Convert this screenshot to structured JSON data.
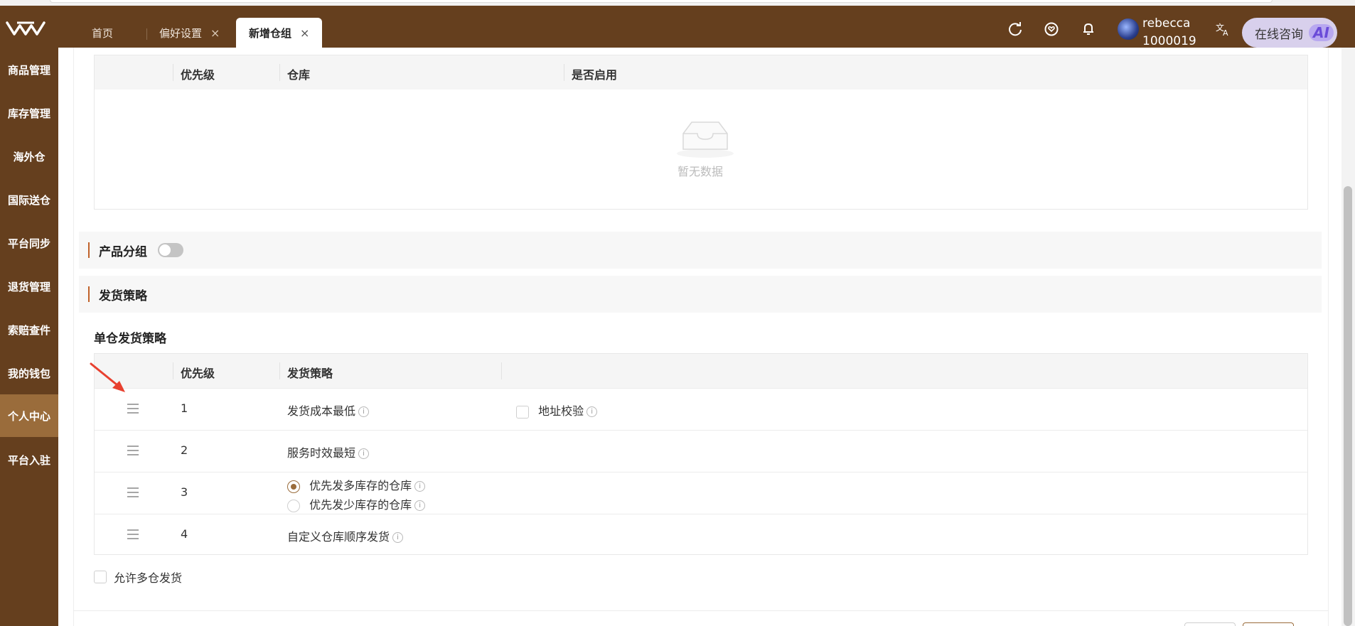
{
  "header": {
    "tabs": [
      {
        "label": "首页",
        "closable": false,
        "active": false
      },
      {
        "label": "偏好设置",
        "closable": true,
        "active": false
      },
      {
        "label": "新增仓组",
        "closable": true,
        "active": true
      }
    ],
    "close_glyph": "×",
    "icons": [
      "refresh-icon",
      "heart-icon",
      "bell-icon",
      "translate-icon"
    ],
    "user": {
      "name": "rebecca",
      "id": "1000019"
    },
    "consult": {
      "label": "在线咨询",
      "badge": "AI"
    },
    "colors": {
      "brand": "#653f1e",
      "sidebar_active": "#9a6c3b"
    }
  },
  "sidebar": {
    "items": [
      {
        "label": "商品管理",
        "active": false
      },
      {
        "label": "库存管理",
        "active": false
      },
      {
        "label": "海外仓",
        "active": false
      },
      {
        "label": "国际送仓",
        "active": false
      },
      {
        "label": "平台同步",
        "active": false
      },
      {
        "label": "退货管理",
        "active": false
      },
      {
        "label": "索赔查件",
        "active": false
      },
      {
        "label": "我的钱包",
        "active": false
      },
      {
        "label": "个人中心",
        "active": true
      },
      {
        "label": "平台入驻",
        "active": false
      }
    ]
  },
  "warehouse_table": {
    "columns": [
      "优先级",
      "仓库",
      "是否启用"
    ],
    "empty_text": "暂无数据"
  },
  "product_group": {
    "title": "产品分组",
    "enabled": false
  },
  "shipping_strategy": {
    "title": "发货策略"
  },
  "single_strategy": {
    "title": "单仓发货策略",
    "columns": [
      "优先级",
      "发货策略"
    ],
    "rows": [
      {
        "priority": "1",
        "strategy": "发货成本最低",
        "extra_option": "地址校验",
        "extra_checked": false
      },
      {
        "priority": "2",
        "strategy": "服务时效最短"
      },
      {
        "priority": "3",
        "options": [
          {
            "label": "优先发多库存的仓库",
            "selected": true
          },
          {
            "label": "优先发少库存的仓库",
            "selected": false
          }
        ]
      },
      {
        "priority": "4",
        "strategy": "自定义仓库顺序发货"
      }
    ]
  },
  "allow_multi": {
    "label": "允许多仓发货",
    "checked": false
  }
}
